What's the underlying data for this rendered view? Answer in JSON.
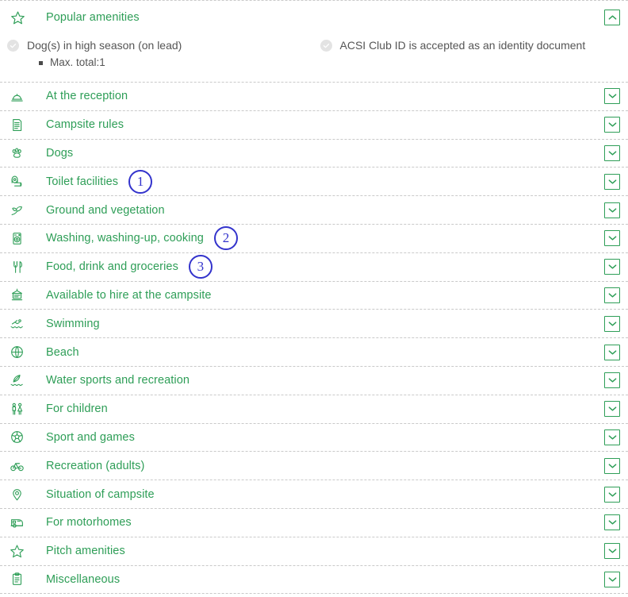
{
  "popular": {
    "icon": "star-icon",
    "title": "Popular amenities",
    "collapse_button": "chevron-up-icon",
    "items": [
      {
        "icon": "check-circle-icon",
        "label": "Dog(s) in high season (on lead)",
        "detail": "Max. total:1"
      },
      {
        "icon": "check-circle-icon",
        "label": "ACSI Club ID is accepted as an identity document",
        "detail": ""
      }
    ]
  },
  "categories": [
    {
      "icon": "reception-bell-icon",
      "label": "At the reception",
      "expand": "chevron-down-icon"
    },
    {
      "icon": "rules-document-icon",
      "label": "Campsite rules",
      "expand": "chevron-down-icon"
    },
    {
      "icon": "paw-print-icon",
      "label": "Dogs",
      "expand": "chevron-down-icon"
    },
    {
      "icon": "toilet-roll-icon",
      "label": "Toilet facilities",
      "expand": "chevron-down-icon"
    },
    {
      "icon": "plant-leaf-icon",
      "label": "Ground and vegetation",
      "expand": "chevron-down-icon"
    },
    {
      "icon": "washing-machine-icon",
      "label": "Washing, washing-up, cooking",
      "expand": "chevron-down-icon"
    },
    {
      "icon": "cutlery-icon",
      "label": "Food, drink and groceries",
      "expand": "chevron-down-icon"
    },
    {
      "icon": "rental-sign-icon",
      "label": "Available to hire at the campsite",
      "expand": "chevron-down-icon"
    },
    {
      "icon": "swimmer-icon",
      "label": "Swimming",
      "expand": "chevron-down-icon"
    },
    {
      "icon": "beach-ball-icon",
      "label": "Beach",
      "expand": "chevron-down-icon"
    },
    {
      "icon": "windsurf-icon",
      "label": "Water sports and recreation",
      "expand": "chevron-down-icon"
    },
    {
      "icon": "children-icon",
      "label": "For children",
      "expand": "chevron-down-icon"
    },
    {
      "icon": "football-icon",
      "label": "Sport and games",
      "expand": "chevron-down-icon"
    },
    {
      "icon": "bicycle-icon",
      "label": "Recreation (adults)",
      "expand": "chevron-down-icon"
    },
    {
      "icon": "map-pin-icon",
      "label": "Situation of campsite",
      "expand": "chevron-down-icon"
    },
    {
      "icon": "motorhome-icon",
      "label": "For motorhomes",
      "expand": "chevron-down-icon"
    },
    {
      "icon": "star-icon",
      "label": "Pitch amenities",
      "expand": "chevron-down-icon"
    },
    {
      "icon": "clipboard-icon",
      "label": "Miscellaneous",
      "expand": "chevron-down-icon"
    }
  ],
  "annotations": [
    {
      "number": "1",
      "target": "Toilet facilities"
    },
    {
      "number": "2",
      "target": "Washing, washing-up, cooking"
    },
    {
      "number": "3",
      "target": "Food, drink and groceries"
    }
  ],
  "colors": {
    "accent_green": "#2e9e57",
    "text_gray": "#555555",
    "rule_gray": "#c9c9c9",
    "annotation_blue": "#3333cc"
  }
}
